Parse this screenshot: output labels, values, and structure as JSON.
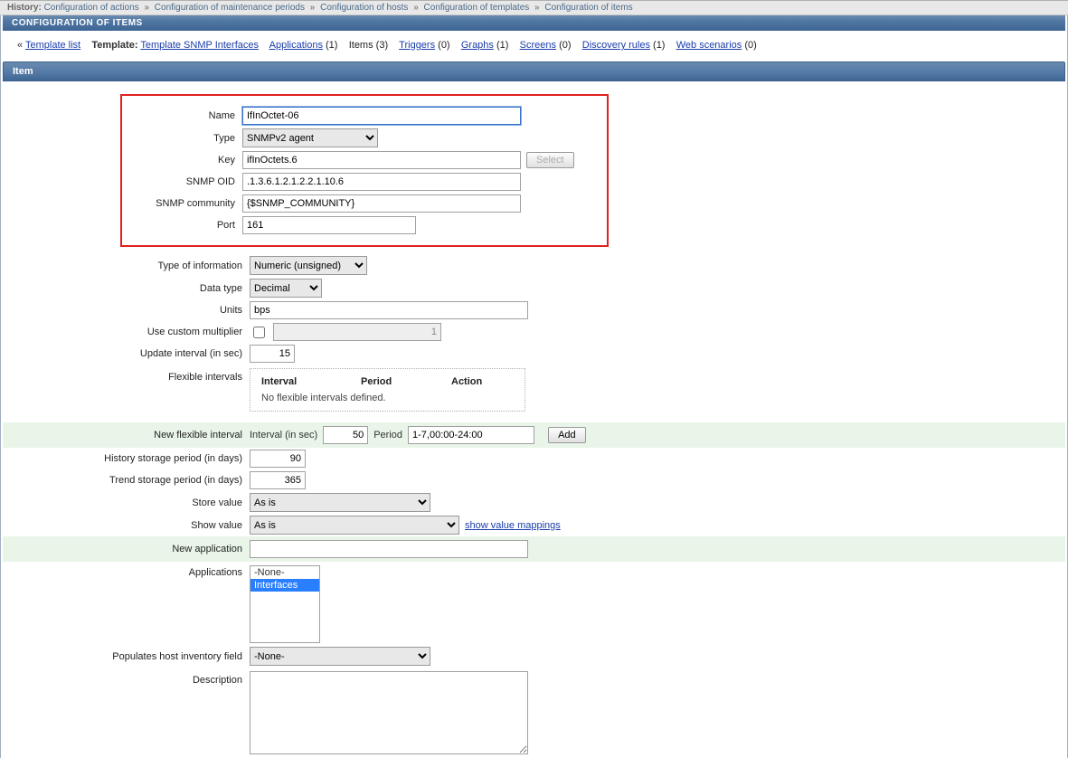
{
  "history": {
    "label": "History:",
    "items": [
      "Configuration of actions",
      "Configuration of maintenance periods",
      "Configuration of hosts",
      "Configuration of templates",
      "Configuration of items"
    ]
  },
  "titlebar": "CONFIGURATION OF ITEMS",
  "linkbar": {
    "back": "«",
    "template_list": "Template list",
    "template_label": "Template:",
    "template_name": "Template SNMP Interfaces",
    "applications": "Applications",
    "applications_count": "(1)",
    "items": "Items",
    "items_count": "(3)",
    "triggers": "Triggers",
    "triggers_count": "(0)",
    "graphs": "Graphs",
    "graphs_count": "(1)",
    "screens": "Screens",
    "screens_count": "(0)",
    "discovery": "Discovery rules",
    "discovery_count": "(1)",
    "web": "Web scenarios",
    "web_count": "(0)"
  },
  "section_header": "Item",
  "form": {
    "labels": {
      "name": "Name",
      "type": "Type",
      "key": "Key",
      "snmp_oid": "SNMP OID",
      "snmp_community": "SNMP community",
      "port": "Port",
      "type_info": "Type of information",
      "data_type": "Data type",
      "units": "Units",
      "custom_mult": "Use custom multiplier",
      "update_int": "Update interval (in sec)",
      "flex_int": "Flexible intervals",
      "new_flex_int": "New flexible interval",
      "hist_storage": "History storage period (in days)",
      "trend_storage": "Trend storage period (in days)",
      "store_value": "Store value",
      "show_value": "Show value",
      "new_app": "New application",
      "applications": "Applications",
      "host_inv": "Populates host inventory field",
      "description": "Description"
    },
    "values": {
      "name": "IfInOctet-06",
      "type": "SNMPv2 agent",
      "key": "ifInOctets.6",
      "key_btn": "Select",
      "snmp_oid": ".1.3.6.1.2.1.2.2.1.10.6",
      "snmp_community": "{$SNMP_COMMUNITY}",
      "port": "161",
      "type_info": "Numeric (unsigned)",
      "data_type": "Decimal",
      "units": "bps",
      "custom_mult_checked": false,
      "custom_mult_value": "1",
      "update_int": "15",
      "flex_headers": {
        "interval": "Interval",
        "period": "Period",
        "action": "Action"
      },
      "flex_empty": "No flexible intervals defined.",
      "new_flex_int_label": "Interval (in sec)",
      "new_flex_int_val": "50",
      "new_flex_period_label": "Period",
      "new_flex_period_val": "1-7,00:00-24:00",
      "add_btn": "Add",
      "hist_storage": "90",
      "trend_storage": "365",
      "store_value": "As is",
      "show_value": "As is",
      "show_value_link": "show value mappings",
      "new_app": "",
      "app_none": "-None-",
      "app_interfaces": "Interfaces",
      "host_inv": "-None-",
      "description": ""
    }
  }
}
